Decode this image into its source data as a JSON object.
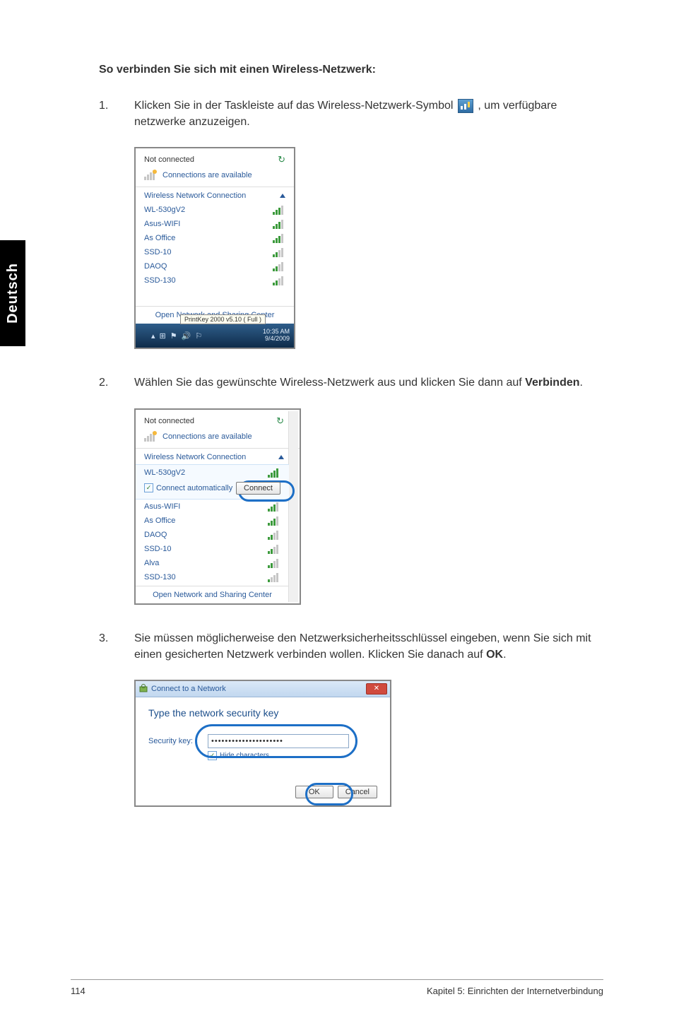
{
  "lang_tab": "Deutsch",
  "heading": "So verbinden Sie sich mit einen Wireless-Netzwerk:",
  "step1": {
    "num": "1.",
    "pre": "Klicken Sie in der Taskleiste auf das Wireless-Netzwerk-Symbol ",
    "post": ", um verfügbare netzwerke anzuzeigen."
  },
  "step2": {
    "num": "2.",
    "text_a": "Wählen Sie das gewünschte Wireless-Netzwerk aus und klicken Sie dann auf ",
    "text_b": "Verbinden",
    "text_c": "."
  },
  "step3": {
    "num": "3.",
    "text_a": "Sie müssen möglicherweise den Netzwerksicherheitsschlüssel eingeben, wenn Sie sich mit einen gesicherten Netzwerk verbinden wollen. Klicken Sie danach auf ",
    "text_b": "OK",
    "text_c": "."
  },
  "flyout": {
    "not_connected": "Not connected",
    "available": "Connections are available",
    "section": "Wireless Network Connection",
    "open_center": "Open Network and Sharing Center",
    "tooltip": "PrintKey 2000  v5.10 ( Full )",
    "time": "10:35 AM",
    "date": "9/4/2009"
  },
  "networks1": [
    {
      "name": "WL-530gV2",
      "signal": 3
    },
    {
      "name": "Asus-WIFI",
      "signal": 3
    },
    {
      "name": "As Office",
      "signal": 3
    },
    {
      "name": "SSD-10",
      "signal": 2
    },
    {
      "name": "DAOQ",
      "signal": 2
    },
    {
      "name": "SSD-130",
      "signal": 2
    }
  ],
  "shot2_selected": {
    "name": "WL-530gV2",
    "auto": "Connect automatically",
    "connect": "Connect"
  },
  "networks2": [
    {
      "name": "Asus-WIFI",
      "signal": 3
    },
    {
      "name": "As Office",
      "signal": 3
    },
    {
      "name": "DAOQ",
      "signal": 2
    },
    {
      "name": "SSD-10",
      "signal": 2
    },
    {
      "name": "Alva",
      "signal": 2
    },
    {
      "name": "SSD-130",
      "signal": 1
    }
  ],
  "dialog": {
    "title": "Connect to a Network",
    "head": "Type the network security key",
    "label": "Security key:",
    "value": "•••••••••••••••••••••",
    "hide": "Hide characters",
    "ok": "OK",
    "cancel": "Cancel"
  },
  "footer": {
    "page": "114",
    "chapter": "Kapitel 5: Einrichten der Internetverbindung"
  }
}
